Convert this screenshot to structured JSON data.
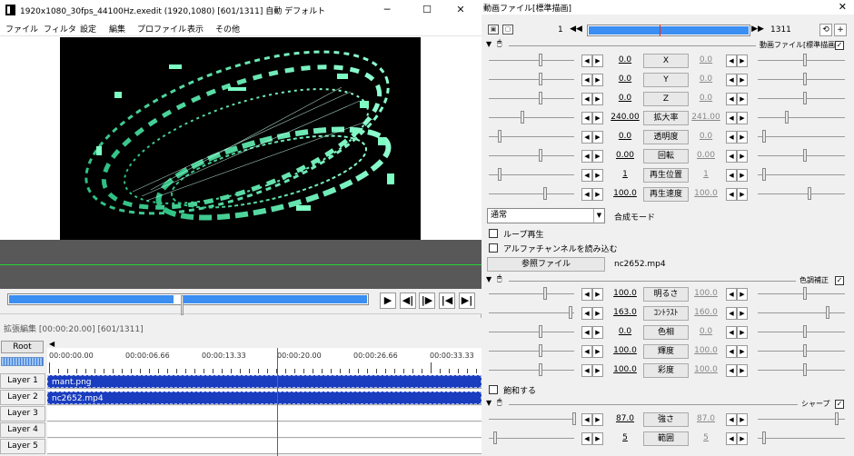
{
  "main_window": {
    "title": "1920x1080_30fps_44100Hz.exedit (1920,1080)  [601/1311]  自動  デフォルト",
    "controls": {
      "minimize": "─",
      "maximize": "☐",
      "close": "✕"
    },
    "menu": [
      "ファイル",
      "フィルタ",
      "設定",
      "編集",
      "プロファイル",
      "表示",
      "その他"
    ]
  },
  "transport": {
    "play": "▶",
    "prev_frame": "◀|",
    "next_frame": "|▶",
    "to_start": "|◀",
    "to_end": "▶|"
  },
  "timeline": {
    "title": "拡張編集 [00:00:20.00] [601/1311]",
    "root_label": "Root",
    "scroll_arrow": "◀",
    "ruler_labels": [
      "00:00:00.00",
      "00:00:06.66",
      "00:00:13.33",
      "00:00:20.00",
      "00:00:26.66",
      "00:00:33.33"
    ],
    "layers": [
      "Layer 1",
      "Layer 2",
      "Layer 3",
      "Layer 4",
      "Layer 5"
    ],
    "clips": [
      {
        "layer": "Layer 1",
        "name": "mant.png"
      },
      {
        "layer": "Layer 2",
        "name": "nc2652.mp4"
      }
    ]
  },
  "settings": {
    "title": "動画ファイル[標準描画]",
    "close": "✕",
    "frame_start": "1",
    "frame_end": "1311",
    "nav_prev": "◀◀",
    "nav_next": "▶▶",
    "btn_icon_a": "▣",
    "btn_icon_b": "▢",
    "btn_reset": "⟲",
    "btn_add": "+",
    "section1_label": "動画ファイル[標準描画]",
    "section1_checked": "✓",
    "params1": [
      {
        "name": "X",
        "left": "0.0",
        "right": "0.0"
      },
      {
        "name": "Y",
        "left": "0.0",
        "right": "0.0"
      },
      {
        "name": "Z",
        "left": "0.0",
        "right": "0.0"
      },
      {
        "name": "拡大率",
        "left": "240.00",
        "right": "241.00"
      },
      {
        "name": "透明度",
        "left": "0.0",
        "right": "0.0"
      },
      {
        "name": "回転",
        "left": "0.00",
        "right": "0.00"
      },
      {
        "name": "再生位置",
        "left": "1",
        "right": "1"
      },
      {
        "name": "再生速度",
        "left": "100.0",
        "right": "100.0"
      }
    ],
    "blend_mode_value": "通常",
    "blend_mode_label": "合成モード",
    "loop_label": "ループ再生",
    "alpha_label": "アルファチャンネルを読み込む",
    "ref_file_button": "参照ファイル",
    "file_name": "nc2652.mp4",
    "section2_label": "色調補正",
    "section2_checked": "✓",
    "params2": [
      {
        "name": "明るさ",
        "left": "100.0",
        "right": "100.0"
      },
      {
        "name": "ｺﾝﾄﾗｽﾄ",
        "left": "163.0",
        "right": "160.0"
      },
      {
        "name": "色相",
        "left": "0.0",
        "right": "0.0"
      },
      {
        "name": "輝度",
        "left": "100.0",
        "right": "100.0"
      },
      {
        "name": "彩度",
        "left": "100.0",
        "right": "100.0"
      }
    ],
    "saturate_label": "飽和する",
    "section3_label": "シャープ",
    "section3_checked": "✓",
    "params3": [
      {
        "name": "強さ",
        "left": "87.0",
        "right": "87.0"
      },
      {
        "name": "範囲",
        "left": "5",
        "right": "5"
      }
    ],
    "arrow_left": "◀",
    "arrow_right": "▶",
    "section_toggle": "▼",
    "mouse_icon": "🖱"
  },
  "colors": {
    "accent_blue": "#3b8ef2",
    "clip_blue": "#1a3dbf",
    "playhead_red": "#e52b2b",
    "waveform_green": "#26d43a",
    "art_mint": "#6cf5b2"
  }
}
